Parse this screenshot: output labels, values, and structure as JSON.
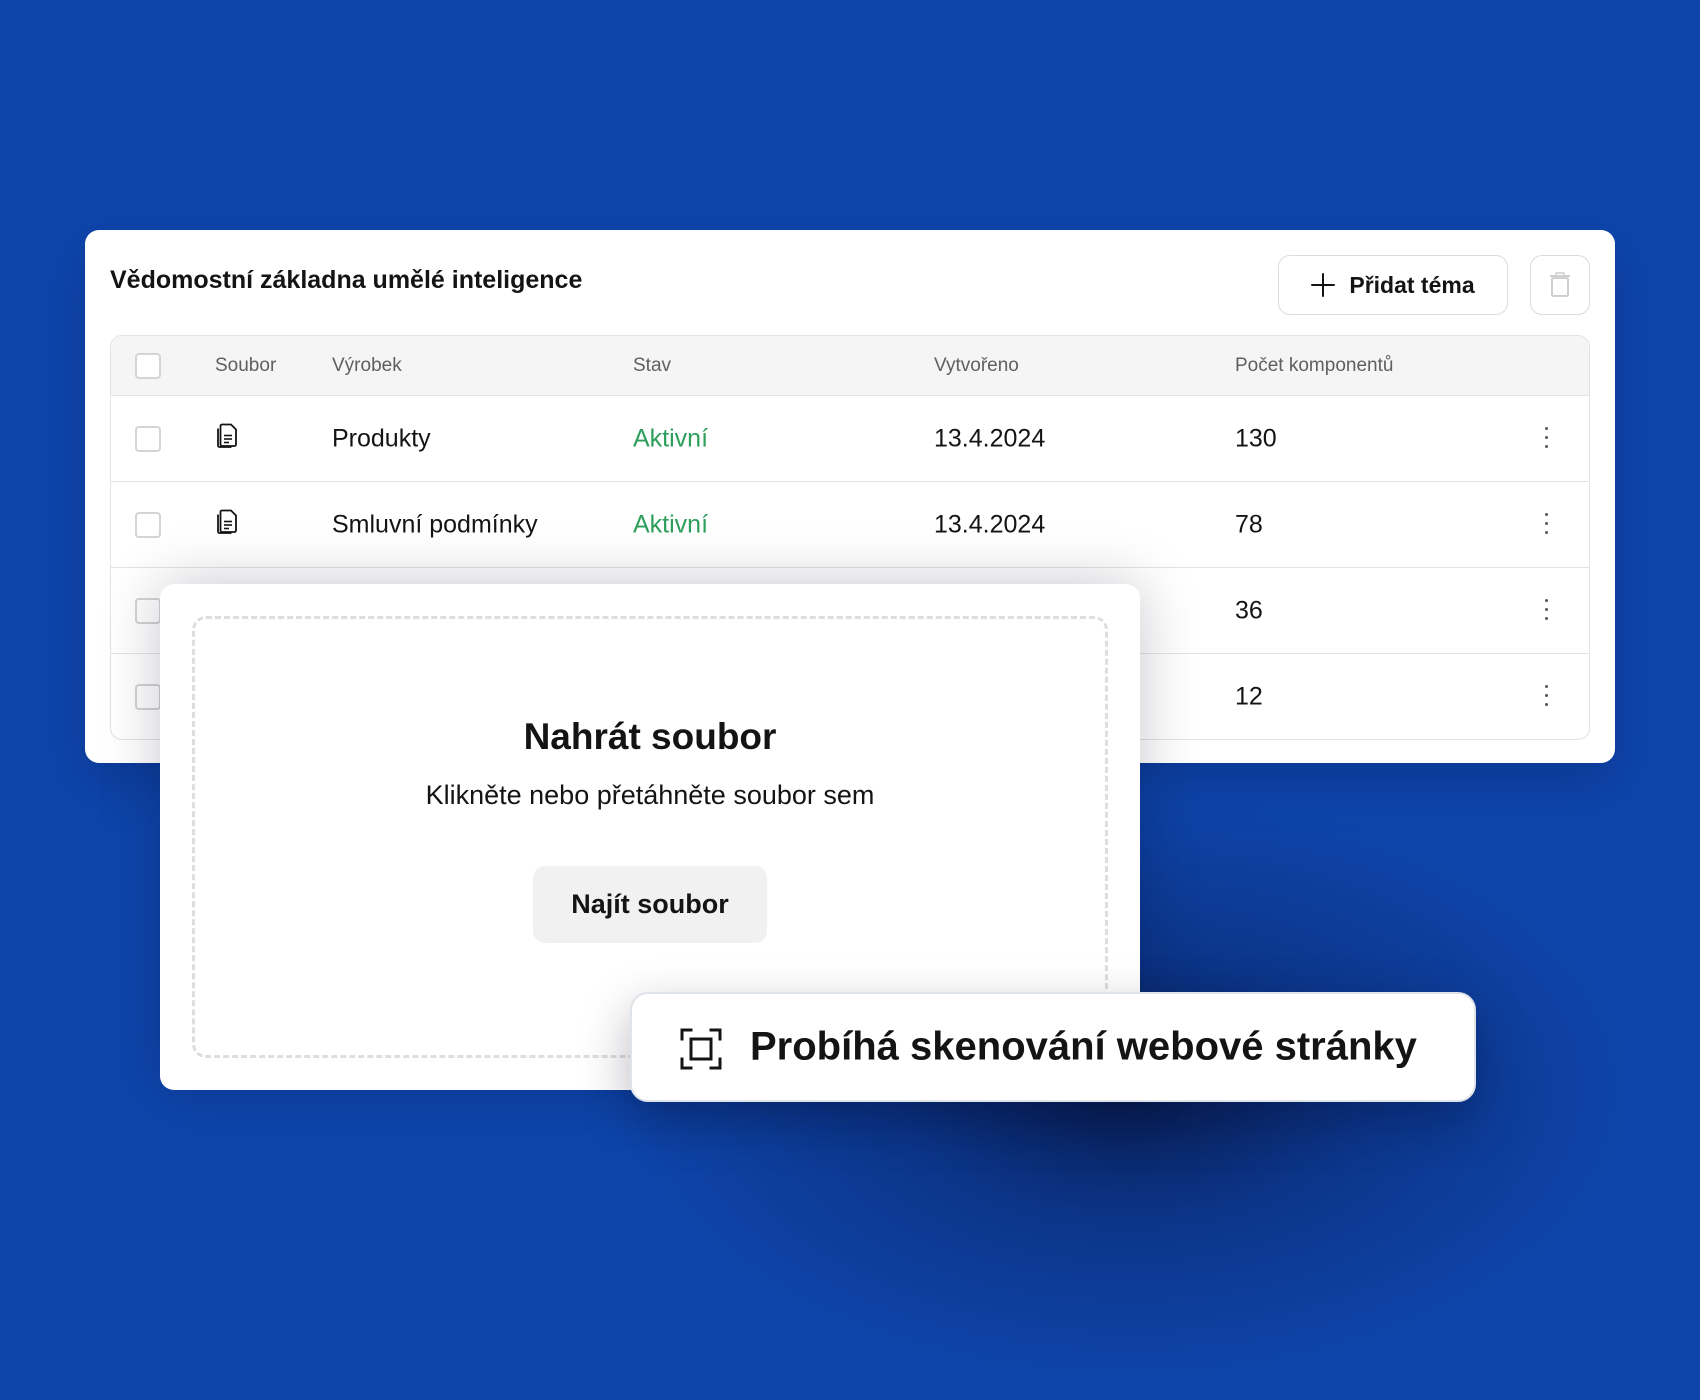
{
  "knowledge_base": {
    "title": "Vědomostní základna umělé inteligence",
    "add_button_label": "Přidat téma",
    "columns": {
      "file": "Soubor",
      "product": "Výrobek",
      "status": "Stav",
      "created": "Vytvořeno",
      "component_count": "Počet komponentů"
    },
    "rows": [
      {
        "product": "Produkty",
        "status": "Aktivní",
        "created": "13.4.2024",
        "component_count": "130"
      },
      {
        "product": "Smluvní podmínky",
        "status": "Aktivní",
        "created": "13.4.2024",
        "component_count": "78"
      },
      {
        "product": "",
        "status": "",
        "created": "",
        "component_count": "36"
      },
      {
        "product": "",
        "status": "",
        "created": "",
        "component_count": "12"
      }
    ]
  },
  "upload": {
    "title": "Nahrát soubor",
    "subtitle": "Klikněte nebo přetáhněte soubor sem",
    "button_label": "Najít soubor"
  },
  "scan_toast": {
    "label": "Probíhá skenování webové stránky",
    "icon": "scan-icon"
  },
  "colors": {
    "background": "#0e45ab",
    "status_active": "#2e9e5b",
    "card": "#ffffff"
  }
}
